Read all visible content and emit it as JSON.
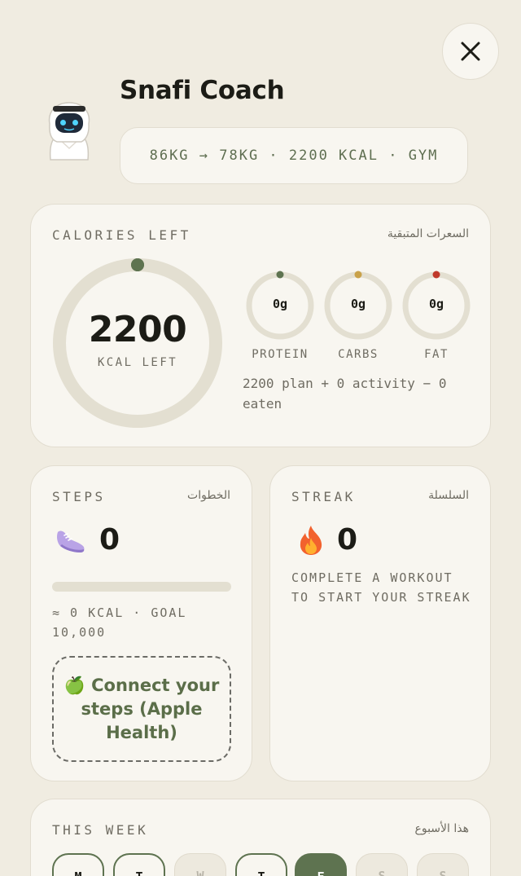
{
  "header": {
    "title": "Snafi Coach",
    "goal_summary": "86KG → 78KG · 2200 KCAL · GYM"
  },
  "calories": {
    "label": "CALORIES LEFT",
    "label_ar": "السعرات المتبقية",
    "remaining": "2200",
    "unit": "KCAL LEFT",
    "progress": 0,
    "formula": "2200 plan + 0 activity − 0 eaten",
    "macros": [
      {
        "name": "PROTEIN",
        "value": "0g",
        "color": "#5e7350"
      },
      {
        "name": "CARBS",
        "value": "0g",
        "color": "#c9a24a"
      },
      {
        "name": "FAT",
        "value": "0g",
        "color": "#c0392b"
      }
    ]
  },
  "steps": {
    "label": "STEPS",
    "label_ar": "الخطوات",
    "count": "0",
    "progress": 0,
    "meta": "≈ 0 KCAL · GOAL 10,000",
    "connect_label": "🍏 Connect your steps (Apple Health)"
  },
  "streak": {
    "label": "STREAK",
    "label_ar": "السلسلة",
    "count": "0",
    "message": "COMPLETE A WORKOUT TO START YOUR STREAK"
  },
  "week": {
    "label": "THIS WEEK",
    "label_ar": "هذا الأسبوع",
    "days": [
      {
        "letter": "M",
        "state": "done"
      },
      {
        "letter": "T",
        "state": "done"
      },
      {
        "letter": "W",
        "state": "off"
      },
      {
        "letter": "T",
        "state": "done"
      },
      {
        "letter": "F",
        "state": "today"
      },
      {
        "letter": "S",
        "state": "off"
      },
      {
        "letter": "S",
        "state": "off"
      }
    ]
  },
  "colors": {
    "background": "#f0ece1",
    "card": "#f8f6f0",
    "accent": "#5e7350",
    "ring_track": "#e3dfd1"
  }
}
